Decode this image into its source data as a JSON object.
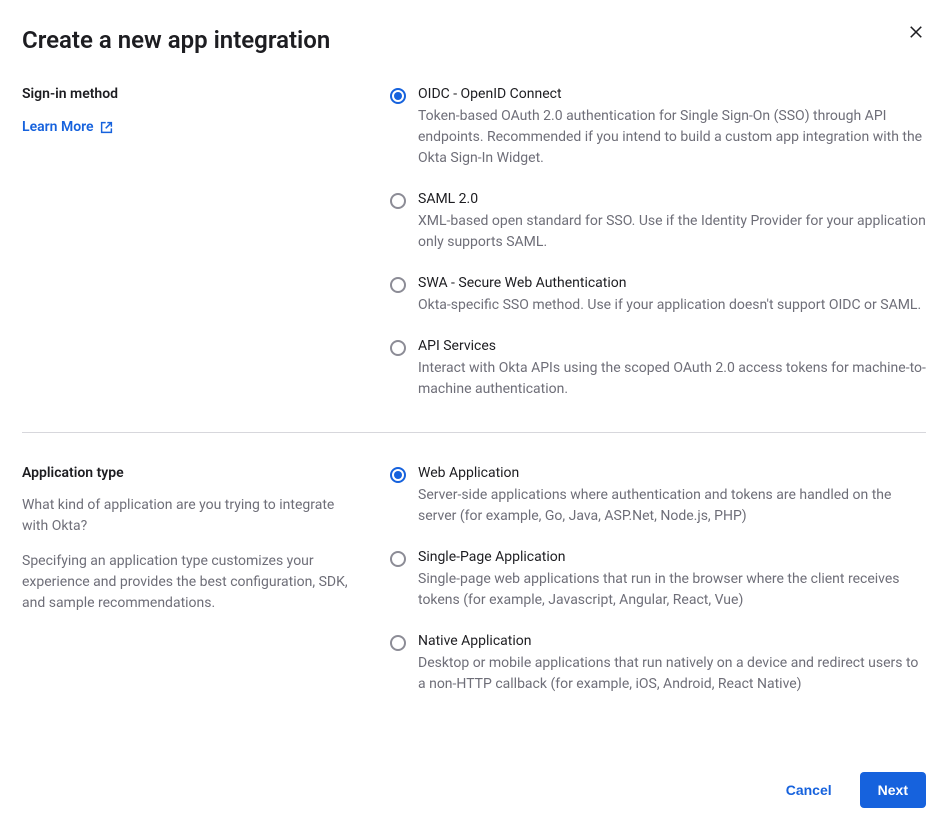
{
  "dialog": {
    "title": "Create a new app integration"
  },
  "sections": {
    "signin": {
      "label": "Sign-in method",
      "learn_more": "Learn More",
      "options": [
        {
          "title": "OIDC - OpenID Connect",
          "desc": "Token-based OAuth 2.0 authentication for Single Sign-On (SSO) through API endpoints. Recommended if you intend to build a custom app integration with the Okta Sign-In Widget.",
          "selected": true
        },
        {
          "title": "SAML 2.0",
          "desc": "XML-based open standard for SSO. Use if the Identity Provider for your application only supports SAML.",
          "selected": false
        },
        {
          "title": "SWA - Secure Web Authentication",
          "desc": "Okta-specific SSO method. Use if your application doesn't support OIDC or SAML.",
          "selected": false
        },
        {
          "title": "API Services",
          "desc": "Interact with Okta APIs using the scoped OAuth 2.0 access tokens for machine-to-machine authentication.",
          "selected": false
        }
      ]
    },
    "apptype": {
      "label": "Application type",
      "helper1": "What kind of application are you trying to integrate with Okta?",
      "helper2": "Specifying an application type customizes your experience and provides the best configuration, SDK, and sample recommendations.",
      "options": [
        {
          "title": "Web Application",
          "desc": "Server-side applications where authentication and tokens are handled on the server (for example, Go, Java, ASP.Net, Node.js, PHP)",
          "selected": true
        },
        {
          "title": "Single-Page Application",
          "desc": "Single-page web applications that run in the browser where the client receives tokens (for example, Javascript, Angular, React, Vue)",
          "selected": false
        },
        {
          "title": "Native Application",
          "desc": "Desktop or mobile applications that run natively on a device and redirect users to a non-HTTP callback (for example, iOS, Android, React Native)",
          "selected": false
        }
      ]
    }
  },
  "footer": {
    "cancel": "Cancel",
    "next": "Next"
  }
}
